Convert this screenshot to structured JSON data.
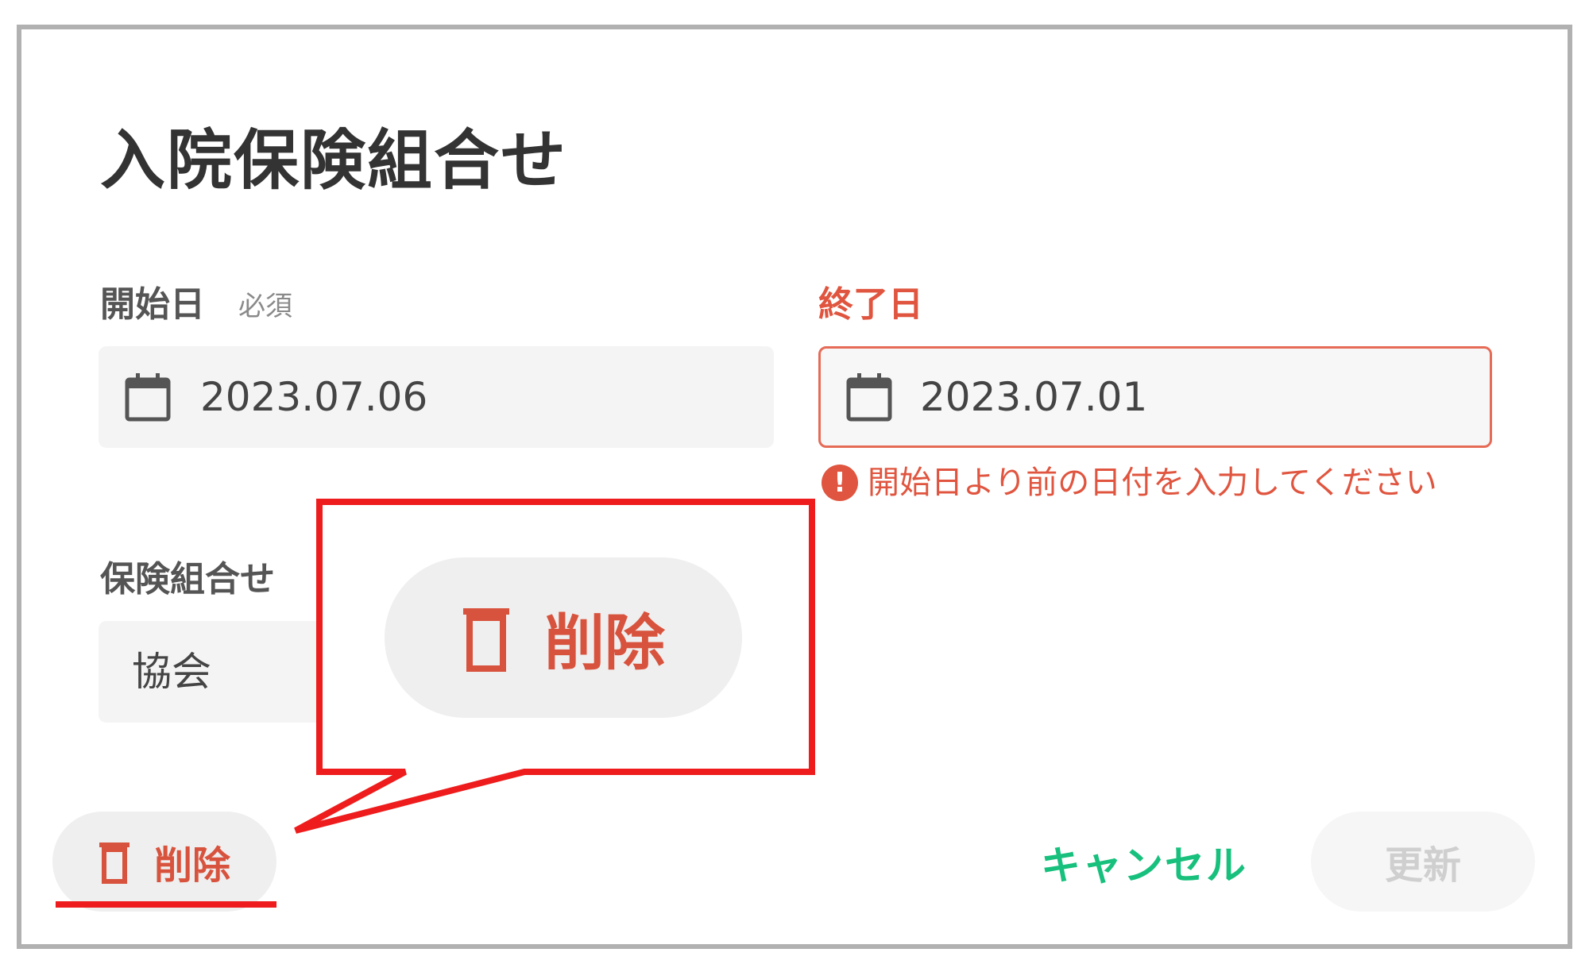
{
  "dialog": {
    "title": "入院保険組合せ"
  },
  "start_date": {
    "label": "開始日",
    "required_tag": "必須",
    "value": "2023.07.06"
  },
  "end_date": {
    "label": "終了日",
    "value": "2023.07.01",
    "error_message": "開始日より前の日付を入力してください",
    "error_icon": "!"
  },
  "insurance": {
    "label": "保険組合せ",
    "value": "協会"
  },
  "footer": {
    "delete_label": "削除",
    "cancel_label": "キャンセル",
    "update_label": "更新"
  },
  "callout": {
    "delete_label": "削除"
  },
  "colors": {
    "error": "#e0553f",
    "delete": "#d8533d",
    "cancel": "#17c07c",
    "annotation": "#ee1c1c"
  }
}
